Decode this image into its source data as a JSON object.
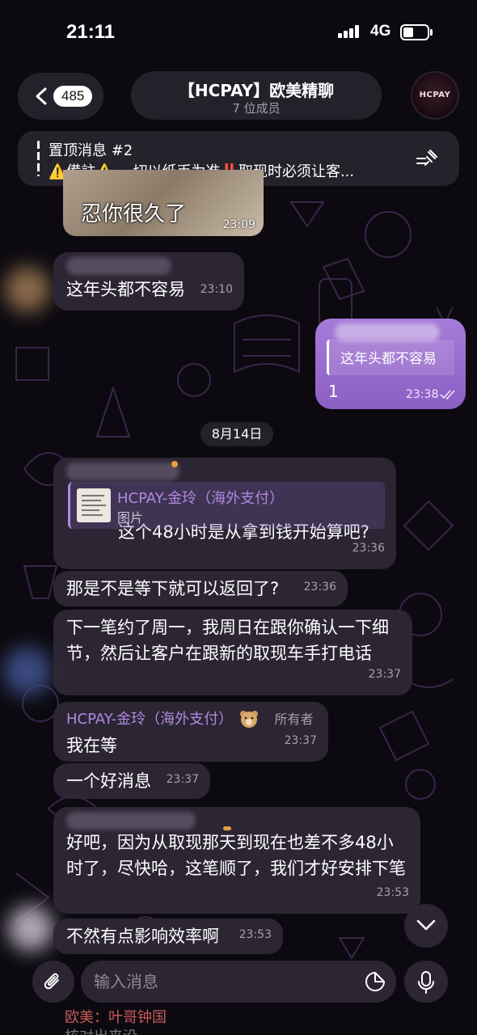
{
  "status_bar": {
    "time": "21:11",
    "network": "4G"
  },
  "header": {
    "back_count": "485",
    "title": "【HCPAY】欧美精聊",
    "subtitle": "7 位成员",
    "avatar_text": "HCPAY"
  },
  "pinned": {
    "title": "置顶消息 #2",
    "text": "⚠️備註⚠️ 一切以纸币为准‼️取现时必须让客..."
  },
  "messages": [
    {
      "id": "image",
      "caption": "忍你很久了",
      "time": "23:09"
    },
    {
      "id": "m1",
      "text": "这年头都不容易",
      "time": "23:10"
    },
    {
      "id": "out",
      "reply_text": "这年头都不容易",
      "text": "1",
      "time": "23:38"
    },
    {
      "id": "m2",
      "quote_name": "HCPAY-金玲（海外支付）",
      "quote_sub": "图片",
      "text": "这个48小时是从拿到钱开始算吧?",
      "time": "23:36"
    },
    {
      "id": "m3",
      "text": "那是不是等下就可以返回了?",
      "time": "23:36"
    },
    {
      "id": "m4",
      "text": "下一笔约了周一，我周日在跟你确认一下细节，然后让客户在跟新的取现车手打电话",
      "time": "23:37"
    },
    {
      "id": "m5",
      "sender": "HCPAY-金玲（海外支付）",
      "tag": "所有者",
      "text": "我在等",
      "time": "23:37"
    },
    {
      "id": "m6",
      "text": "一个好消息",
      "time": "23:37"
    },
    {
      "id": "m7",
      "text": "好吧，因为从取现那天到现在也差不多48小时了，尽快哈，这笔顺了，我们才好安排下笔",
      "time": "23:53"
    },
    {
      "id": "m8",
      "text": "不然有点影响效率啊",
      "time": "23:53"
    }
  ],
  "date_divider": "8月14日",
  "composer": {
    "placeholder": "输入消息"
  },
  "peek": {
    "line1": "欧美：叶哥钟国",
    "line2": "核对出来没"
  },
  "colors": {
    "accent": "#b088e0",
    "outgoing": "#9a6dcf",
    "bubble": "#2e2836",
    "background": "#0c0a10"
  }
}
